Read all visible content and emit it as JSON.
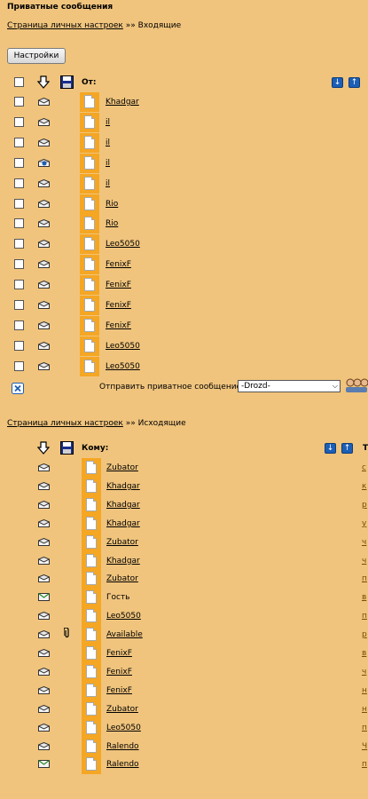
{
  "page": {
    "title": "Приватные сообщения",
    "settings_label": "Настройки"
  },
  "inbox": {
    "breadcrumb_link": "Страница личных настроек",
    "breadcrumb_sep": "»»",
    "breadcrumb_current": "Входящие",
    "header_from": "От:",
    "rows": [
      {
        "from": "Khadgar",
        "read": true
      },
      {
        "from": "il",
        "read": true
      },
      {
        "from": "il",
        "read": true
      },
      {
        "from": "il",
        "read": false
      },
      {
        "from": "il",
        "read": true
      },
      {
        "from": "Rio",
        "read": true
      },
      {
        "from": "Rio",
        "read": true
      },
      {
        "from": "Leo5050",
        "read": true
      },
      {
        "from": "FenixF",
        "read": true
      },
      {
        "from": "FenixF",
        "read": true
      },
      {
        "from": "FenixF",
        "read": true
      },
      {
        "from": "FenixF",
        "read": true
      },
      {
        "from": "Leo5050",
        "read": true
      },
      {
        "from": "Leo5050",
        "read": true
      }
    ],
    "send_label": "Отправить приватное сообщение :",
    "send_select_value": "-Drozd-"
  },
  "outbox": {
    "breadcrumb_link": "Страница личных настроек",
    "breadcrumb_sep": "»»",
    "breadcrumb_current": "Исходящие",
    "header_to": "Кому:",
    "header_topic_partial": "Т",
    "rows": [
      {
        "to": "Zubator",
        "linked": true,
        "status": "read",
        "attachment": false,
        "topic_partial": "с"
      },
      {
        "to": "Khadgar",
        "linked": true,
        "status": "read",
        "attachment": false,
        "topic_partial": "к"
      },
      {
        "to": "Khadgar",
        "linked": true,
        "status": "read",
        "attachment": false,
        "topic_partial": "р"
      },
      {
        "to": "Khadgar",
        "linked": true,
        "status": "read",
        "attachment": false,
        "topic_partial": "у"
      },
      {
        "to": "Zubator",
        "linked": true,
        "status": "read",
        "attachment": false,
        "topic_partial": "ч"
      },
      {
        "to": "Khadgar",
        "linked": true,
        "status": "read",
        "attachment": false,
        "topic_partial": "ч"
      },
      {
        "to": "Zubator",
        "linked": true,
        "status": "read",
        "attachment": false,
        "topic_partial": "п"
      },
      {
        "to": "Гость",
        "linked": false,
        "status": "unread",
        "attachment": false,
        "topic_partial": "в"
      },
      {
        "to": "Leo5050",
        "linked": true,
        "status": "read",
        "attachment": false,
        "topic_partial": "п"
      },
      {
        "to": "Available",
        "linked": true,
        "status": "read",
        "attachment": true,
        "topic_partial": "р"
      },
      {
        "to": "FenixF",
        "linked": true,
        "status": "read",
        "attachment": false,
        "topic_partial": "в"
      },
      {
        "to": "FenixF",
        "linked": true,
        "status": "read",
        "attachment": false,
        "topic_partial": "ч"
      },
      {
        "to": "FenixF",
        "linked": true,
        "status": "read",
        "attachment": false,
        "topic_partial": "н"
      },
      {
        "to": "Zubator",
        "linked": true,
        "status": "read",
        "attachment": false,
        "topic_partial": "н"
      },
      {
        "to": "Leo5050",
        "linked": true,
        "status": "read",
        "attachment": false,
        "topic_partial": "п"
      },
      {
        "to": "Ralendo",
        "linked": true,
        "status": "read",
        "attachment": false,
        "topic_partial": "Ч"
      },
      {
        "to": "Ralendo",
        "linked": true,
        "status": "unread",
        "attachment": false,
        "topic_partial": "п"
      }
    ]
  }
}
